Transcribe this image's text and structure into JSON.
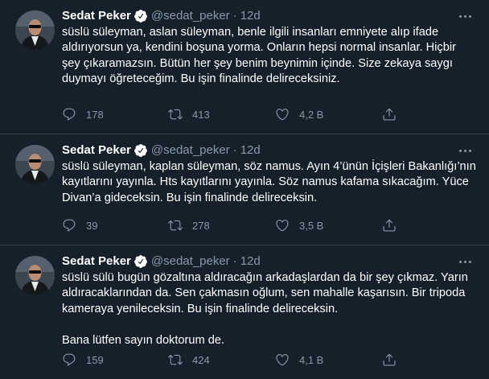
{
  "colors": {
    "background": "#15202b",
    "text_primary": "#ffffff",
    "text_secondary": "#8899a6",
    "divider": "#38444d",
    "verified": "#ffffff"
  },
  "tweets": [
    {
      "author_name": "Sedat Peker",
      "handle": "@sedat_peker",
      "separator": "·",
      "time": "12d",
      "text": "süslü süleyman, aslan süleyman, benle ilgili insanları emniyete alıp ifade aldırıyorsun ya, kendini boşuna yorma. Onların hepsi normal insanlar. Hiçbir şey çıkaramazsın. Bütün her şey benim beynimin içinde. Size zekaya saygı duymayı öğreteceğim. Bu işin finalinde delireceksiniz.",
      "replies": "178",
      "retweets": "413",
      "likes": "4,2 B"
    },
    {
      "author_name": "Sedat Peker",
      "handle": "@sedat_peker",
      "separator": "·",
      "time": "12d",
      "text": "süslü süleyman, kaplan süleyman, söz namus. Ayın 4’ünün İçişleri Bakanlığı’nın kayıtlarını yayınla. Hts kayıtlarını yayınla. Söz namus kafama sıkacağım. Yüce Divan’a gideceksin. Bu işin finalinde delireceksin.",
      "replies": "39",
      "retweets": "278",
      "likes": "3,5 B"
    },
    {
      "author_name": "Sedat Peker",
      "handle": "@sedat_peker",
      "separator": "·",
      "time": "12d",
      "text": "süslü sülü bugün gözaltına aldıracağın arkadaşlardan da bir şey çıkmaz. Yarın aldıracaklarından da. Sen çakmasın oğlum, sen mahalle kaşarısın. Bir tripoda kameraya yenileceksin. Bu işin finalinde delireceksin.\n\nBana lütfen sayın doktorum de.",
      "replies": "159",
      "retweets": "424",
      "likes": "4,1 B"
    }
  ],
  "icons": {
    "avatar": "profile-photo",
    "verified": "verified-badge-icon",
    "more": "more-horizontal-icon",
    "reply": "reply-icon",
    "retweet": "retweet-icon",
    "like": "heart-icon",
    "share": "share-icon"
  }
}
